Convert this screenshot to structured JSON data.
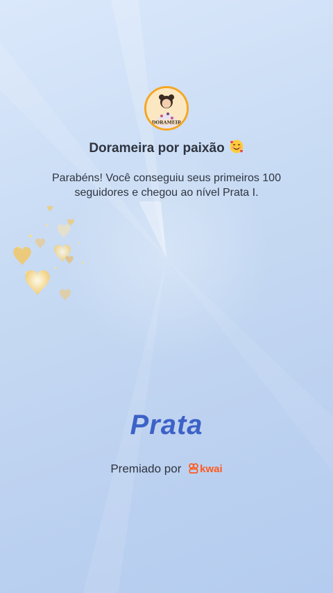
{
  "profile": {
    "name": "Dorameira por paixão",
    "emoji": "🥰",
    "avatar_text": "DORAMEIR"
  },
  "message": "Parabéns! Você conseguiu seus primeiros 100 seguidores e chegou ao nível Prata I.",
  "level": {
    "name": "Prata",
    "color": "#3d62c6"
  },
  "award": {
    "label": "Premiado por",
    "brand": "kwai",
    "brand_color": "#ff5a1f"
  },
  "icons": {
    "brand_icon": "kwai-logo-icon",
    "hearts": "hearts-decoration-icon"
  }
}
